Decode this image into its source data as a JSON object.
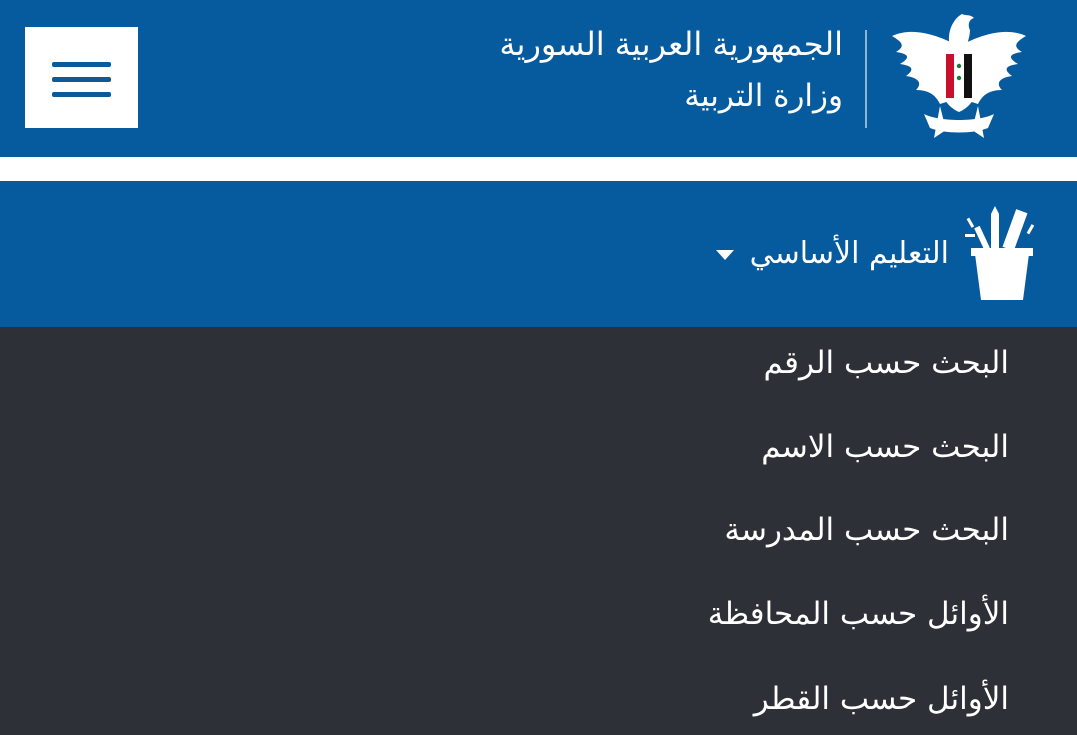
{
  "header": {
    "title_main": "الجمهورية العربية السورية",
    "title_sub": "وزارة التربية",
    "emblem_icon": "syrian-eagle-emblem-icon",
    "menu_icon": "hamburger-menu-icon",
    "background_color": "#065a9e"
  },
  "nav": {
    "section_label": "التعليم الأساسي",
    "section_icon": "pencil-cup-icon",
    "caret_icon": "caret-down-icon"
  },
  "dropdown": {
    "background_color": "#2d3036",
    "items": [
      {
        "label": "البحث حسب الرقم"
      },
      {
        "label": "البحث حسب الاسم"
      },
      {
        "label": "البحث حسب المدرسة"
      },
      {
        "label": "الأوائل حسب المحافظة"
      },
      {
        "label": "الأوائل حسب القطر"
      }
    ]
  }
}
